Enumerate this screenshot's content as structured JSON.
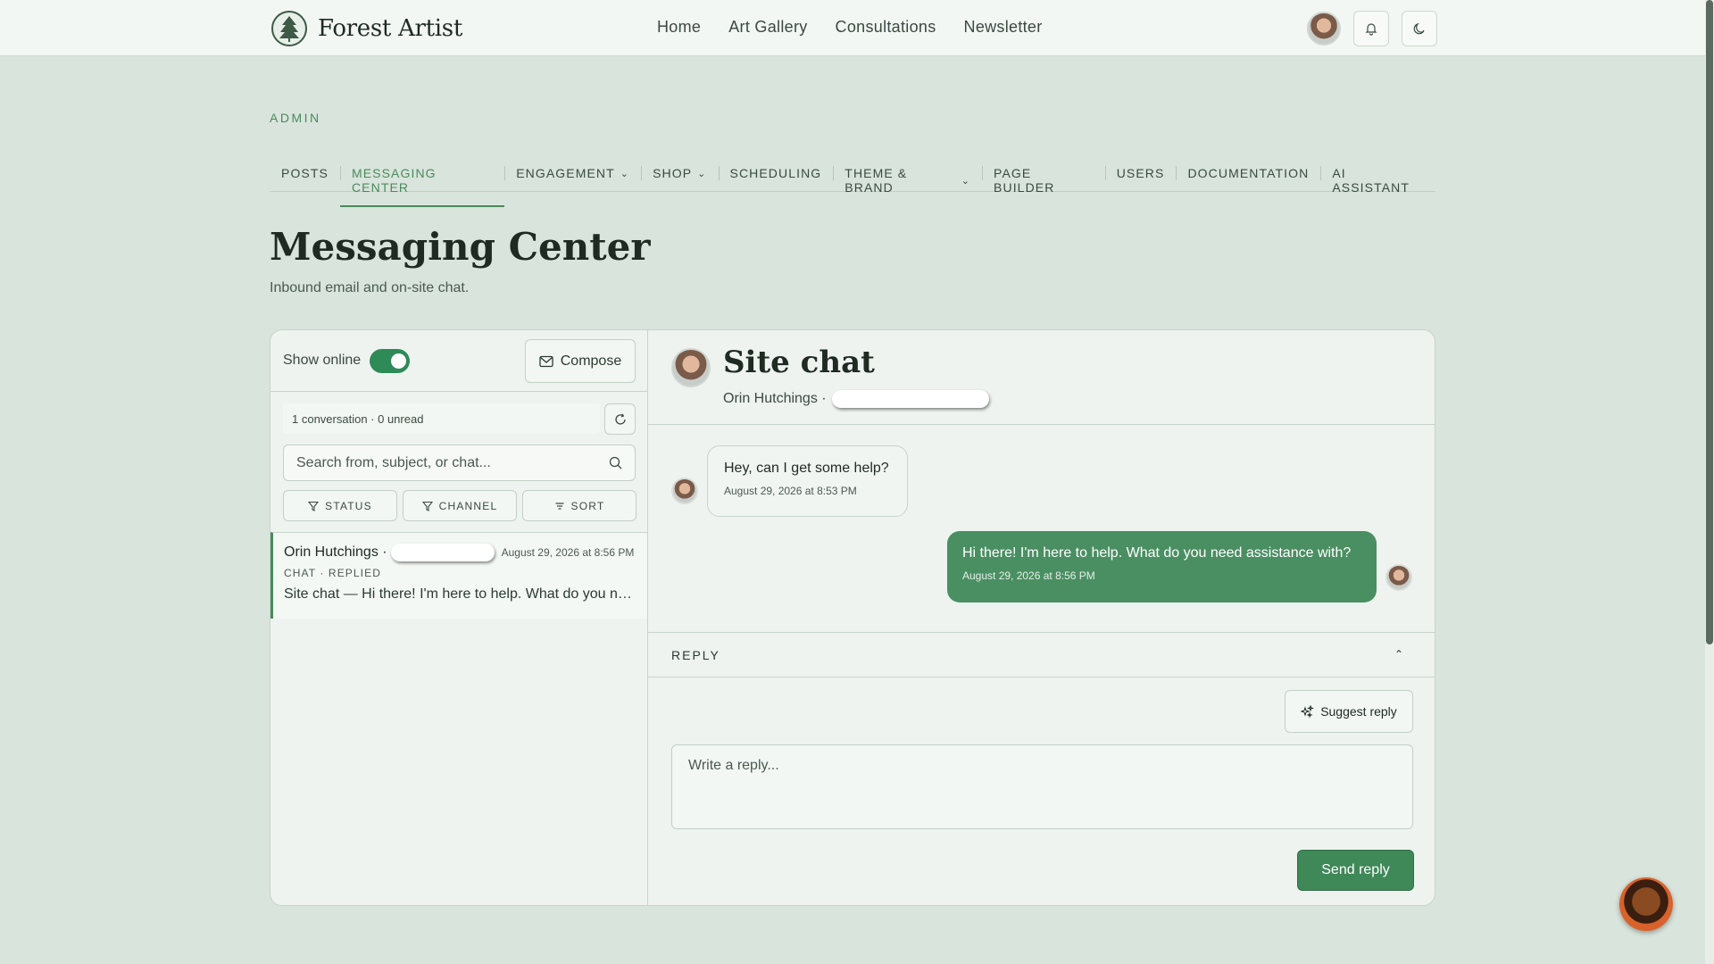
{
  "brand": {
    "name": "Forest Artist",
    "logo_icon": "pine-tree-icon"
  },
  "nav": {
    "links": [
      "Home",
      "Art Gallery",
      "Consultations",
      "Newsletter"
    ]
  },
  "top_actions": {
    "avatar": "user-avatar",
    "notifications_icon": "bell-icon",
    "theme_icon": "moon-icon"
  },
  "admin": {
    "label": "ADMIN",
    "tabs": [
      {
        "label": "POSTS",
        "dropdown": false
      },
      {
        "label": "MESSAGING CENTER",
        "dropdown": false,
        "active": true
      },
      {
        "label": "ENGAGEMENT",
        "dropdown": true
      },
      {
        "label": "SHOP",
        "dropdown": true
      },
      {
        "label": "SCHEDULING",
        "dropdown": false
      },
      {
        "label": "THEME & BRAND",
        "dropdown": true
      },
      {
        "label": "PAGE BUILDER",
        "dropdown": false
      },
      {
        "label": "USERS",
        "dropdown": false
      },
      {
        "label": "DOCUMENTATION",
        "dropdown": false
      },
      {
        "label": "AI ASSISTANT",
        "dropdown": false
      }
    ]
  },
  "page": {
    "title": "Messaging Center",
    "subtitle": "Inbound email and on-site chat."
  },
  "sidebar": {
    "show_online_label": "Show online",
    "show_online": true,
    "compose_label": "Compose",
    "conversation_count": "1 conversation · 0 unread",
    "search_placeholder": "Search from, subject, or chat...",
    "filters": {
      "status": "STATUS",
      "channel": "CHANNEL",
      "sort": "SORT"
    },
    "conversations": [
      {
        "name": "Orin Hutchings ·",
        "time": "August 29, 2026 at 8:56 PM",
        "tags": "CHAT · REPLIED",
        "preview": "Site chat — Hi there! I'm here to help. What do you need assistance with?"
      }
    ]
  },
  "chat": {
    "title": "Site chat",
    "from": "Orin Hutchings ·",
    "messages": [
      {
        "direction": "in",
        "text": "Hey, can I get some help?",
        "time": "August 29, 2026 at 8:53 PM"
      },
      {
        "direction": "out",
        "text": "Hi there! I'm here to help. What do you need assistance with?",
        "time": "August 29, 2026 at 8:56 PM"
      }
    ],
    "reply_header": "REPLY",
    "suggest_label": "Suggest reply",
    "reply_placeholder": "Write a reply...",
    "send_label": "Send reply"
  },
  "colors": {
    "accent": "#4a8a5c",
    "bubble_out": "#4a8f62",
    "background": "#d9e4dc"
  }
}
